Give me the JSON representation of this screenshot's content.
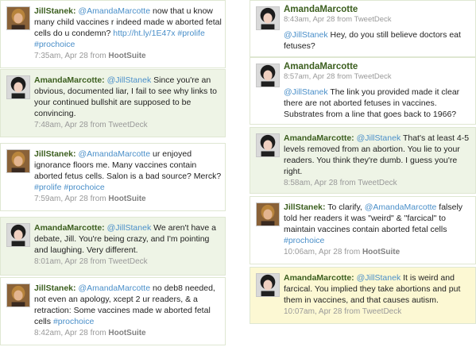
{
  "left": [
    {
      "author": "JillStanek:",
      "avatar": "jill",
      "parts": [
        {
          "t": "mention",
          "v": "@AmandaMarcotte"
        },
        {
          "t": "text",
          "v": " now that u know many child vaccines r indeed made w aborted fetal cells do u condemn? "
        },
        {
          "t": "link",
          "v": "http://ht.ly/1E47x"
        },
        {
          "t": "text",
          "v": " "
        },
        {
          "t": "tag",
          "v": "#prolife"
        },
        {
          "t": "text",
          "v": " "
        },
        {
          "t": "tag",
          "v": "#prochoice"
        }
      ],
      "time": "7:35am, Apr 28 from ",
      "source": "HootSuite"
    },
    {
      "author": "AmandaMarcotte:",
      "avatar": "amanda",
      "parts": [
        {
          "t": "mention",
          "v": "@JillStanek"
        },
        {
          "t": "text",
          "v": " Since you're an obvious, documented liar, I fail to see why links to your continued bullshit are supposed to be convincing."
        }
      ],
      "time": "7:48am, Apr 28 from TweetDeck",
      "source": ""
    },
    {
      "author": "JillStanek:",
      "avatar": "jill",
      "parts": [
        {
          "t": "mention",
          "v": "@AmandaMarcotte"
        },
        {
          "t": "text",
          "v": " ur enjoyed ignorance floors me. Many vaccines contain aborted fetus cells. Salon is a bad source? Merck? "
        },
        {
          "t": "tag",
          "v": "#prolife"
        },
        {
          "t": "text",
          "v": " "
        },
        {
          "t": "tag",
          "v": "#prochoice"
        }
      ],
      "time": "7:59am, Apr 28 from ",
      "source": "HootSuite"
    },
    {
      "author": "AmandaMarcotte:",
      "avatar": "amanda",
      "parts": [
        {
          "t": "mention",
          "v": "@JillStanek"
        },
        {
          "t": "text",
          "v": " We aren't have a debate, Jill. You're being crazy, and I'm pointing and laughing. Very different."
        }
      ],
      "time": "8:01am, Apr 28 from TweetDeck",
      "source": ""
    },
    {
      "author": "JillStanek:",
      "avatar": "jill",
      "parts": [
        {
          "t": "mention",
          "v": "@AmandaMarcotte"
        },
        {
          "t": "text",
          "v": " no deb8 needed, not even an apology, xcept 2 ur readers, & a retraction: Some vaccines made w aborted fetal cells "
        },
        {
          "t": "tag",
          "v": "#prochoice"
        }
      ],
      "time": "8:42am, Apr 28 from ",
      "source": "HootSuite"
    }
  ],
  "right": [
    {
      "author": "AmandaMarcotte",
      "avatar": "amanda",
      "meta": "8:43am, Apr 28 from TweetDeck",
      "parts": [
        {
          "t": "mention",
          "v": "@JillStanek"
        },
        {
          "t": "text",
          "v": " Hey, do you still believe doctors eat fetuses?"
        }
      ]
    },
    {
      "author": "AmandaMarcotte",
      "avatar": "amanda",
      "meta": "8:57am, Apr 28 from TweetDeck",
      "parts": [
        {
          "t": "mention",
          "v": "@JillStanek"
        },
        {
          "t": "text",
          "v": " The link you provided made it clear there are not aborted fetuses in vaccines. Substrates from a line that goes back to 1966?"
        }
      ]
    },
    {
      "author": "AmandaMarcotte:",
      "avatar": "amanda",
      "parts": [
        {
          "t": "mention",
          "v": "@JillStanek"
        },
        {
          "t": "text",
          "v": " That's at least 4-5 levels removed from an abortion. You lie to your readers. You think they're dumb. I guess you're right."
        }
      ],
      "time": "8:58am, Apr 28 from TweetDeck",
      "source": ""
    },
    {
      "author": "JillStanek:",
      "avatar": "jill",
      "parts": [
        {
          "t": "text",
          "v": " To clarify, "
        },
        {
          "t": "mention",
          "v": "@AmandaMarcotte"
        },
        {
          "t": "text",
          "v": " falsely told her readers it was \"weird\" & \"farcical\" to maintain vaccines contain aborted fetal cells "
        },
        {
          "t": "tag",
          "v": "#prochoice"
        }
      ],
      "time": "10:06am, Apr 28 from ",
      "source": "HootSuite"
    },
    {
      "author": "AmandaMarcotte:",
      "avatar": "amanda",
      "parts": [
        {
          "t": "mention",
          "v": "@JillStanek"
        },
        {
          "t": "text",
          "v": " It is weird and farcical. You implied they take abortions and put them in vaccines, and that causes autism."
        }
      ],
      "time": "10:07am, Apr 28 from TweetDeck",
      "source": ""
    }
  ]
}
